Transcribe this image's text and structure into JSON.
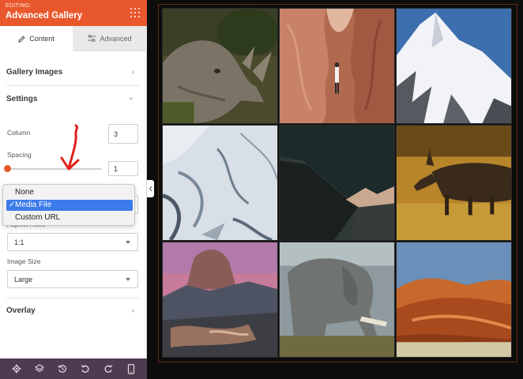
{
  "header": {
    "editing_label": "EDITING:",
    "title": "Advanced Gallery",
    "grid_icon": "grid-icon"
  },
  "tabs": [
    {
      "label": "Content",
      "icon": "pencil-icon",
      "active": true
    },
    {
      "label": "Advanced",
      "icon": "sliders-icon",
      "active": false
    }
  ],
  "sections": {
    "gallery_images": "Gallery Images",
    "settings": "Settings",
    "overlay": "Overlay"
  },
  "settings": {
    "column_label": "Column",
    "column_value": "3",
    "spacing_label": "Spacing",
    "spacing_value": "1",
    "aspect_ratio_label": "Aspect Ratio",
    "aspect_ratio_value": "1:1",
    "image_size_label": "Image Size",
    "image_size_value": "Large"
  },
  "link_dropdown": {
    "options": [
      "None",
      "Media File",
      "Custom URL"
    ],
    "selected": "Media File"
  },
  "toolbar": [
    "gear-icon",
    "layers-icon",
    "history-icon",
    "undo-icon",
    "redo-icon",
    "mobile-preview-icon"
  ],
  "gallery": {
    "images": [
      "rhino",
      "slot canyon",
      "snowy mountain",
      "ice",
      "mountain at dusk",
      "moose",
      "half dome",
      "elephant",
      "desert dunes"
    ]
  },
  "colors": {
    "accent": "#e8582c",
    "toolbar_bg": "#4f3b4f",
    "selection": "#3b7bea"
  }
}
